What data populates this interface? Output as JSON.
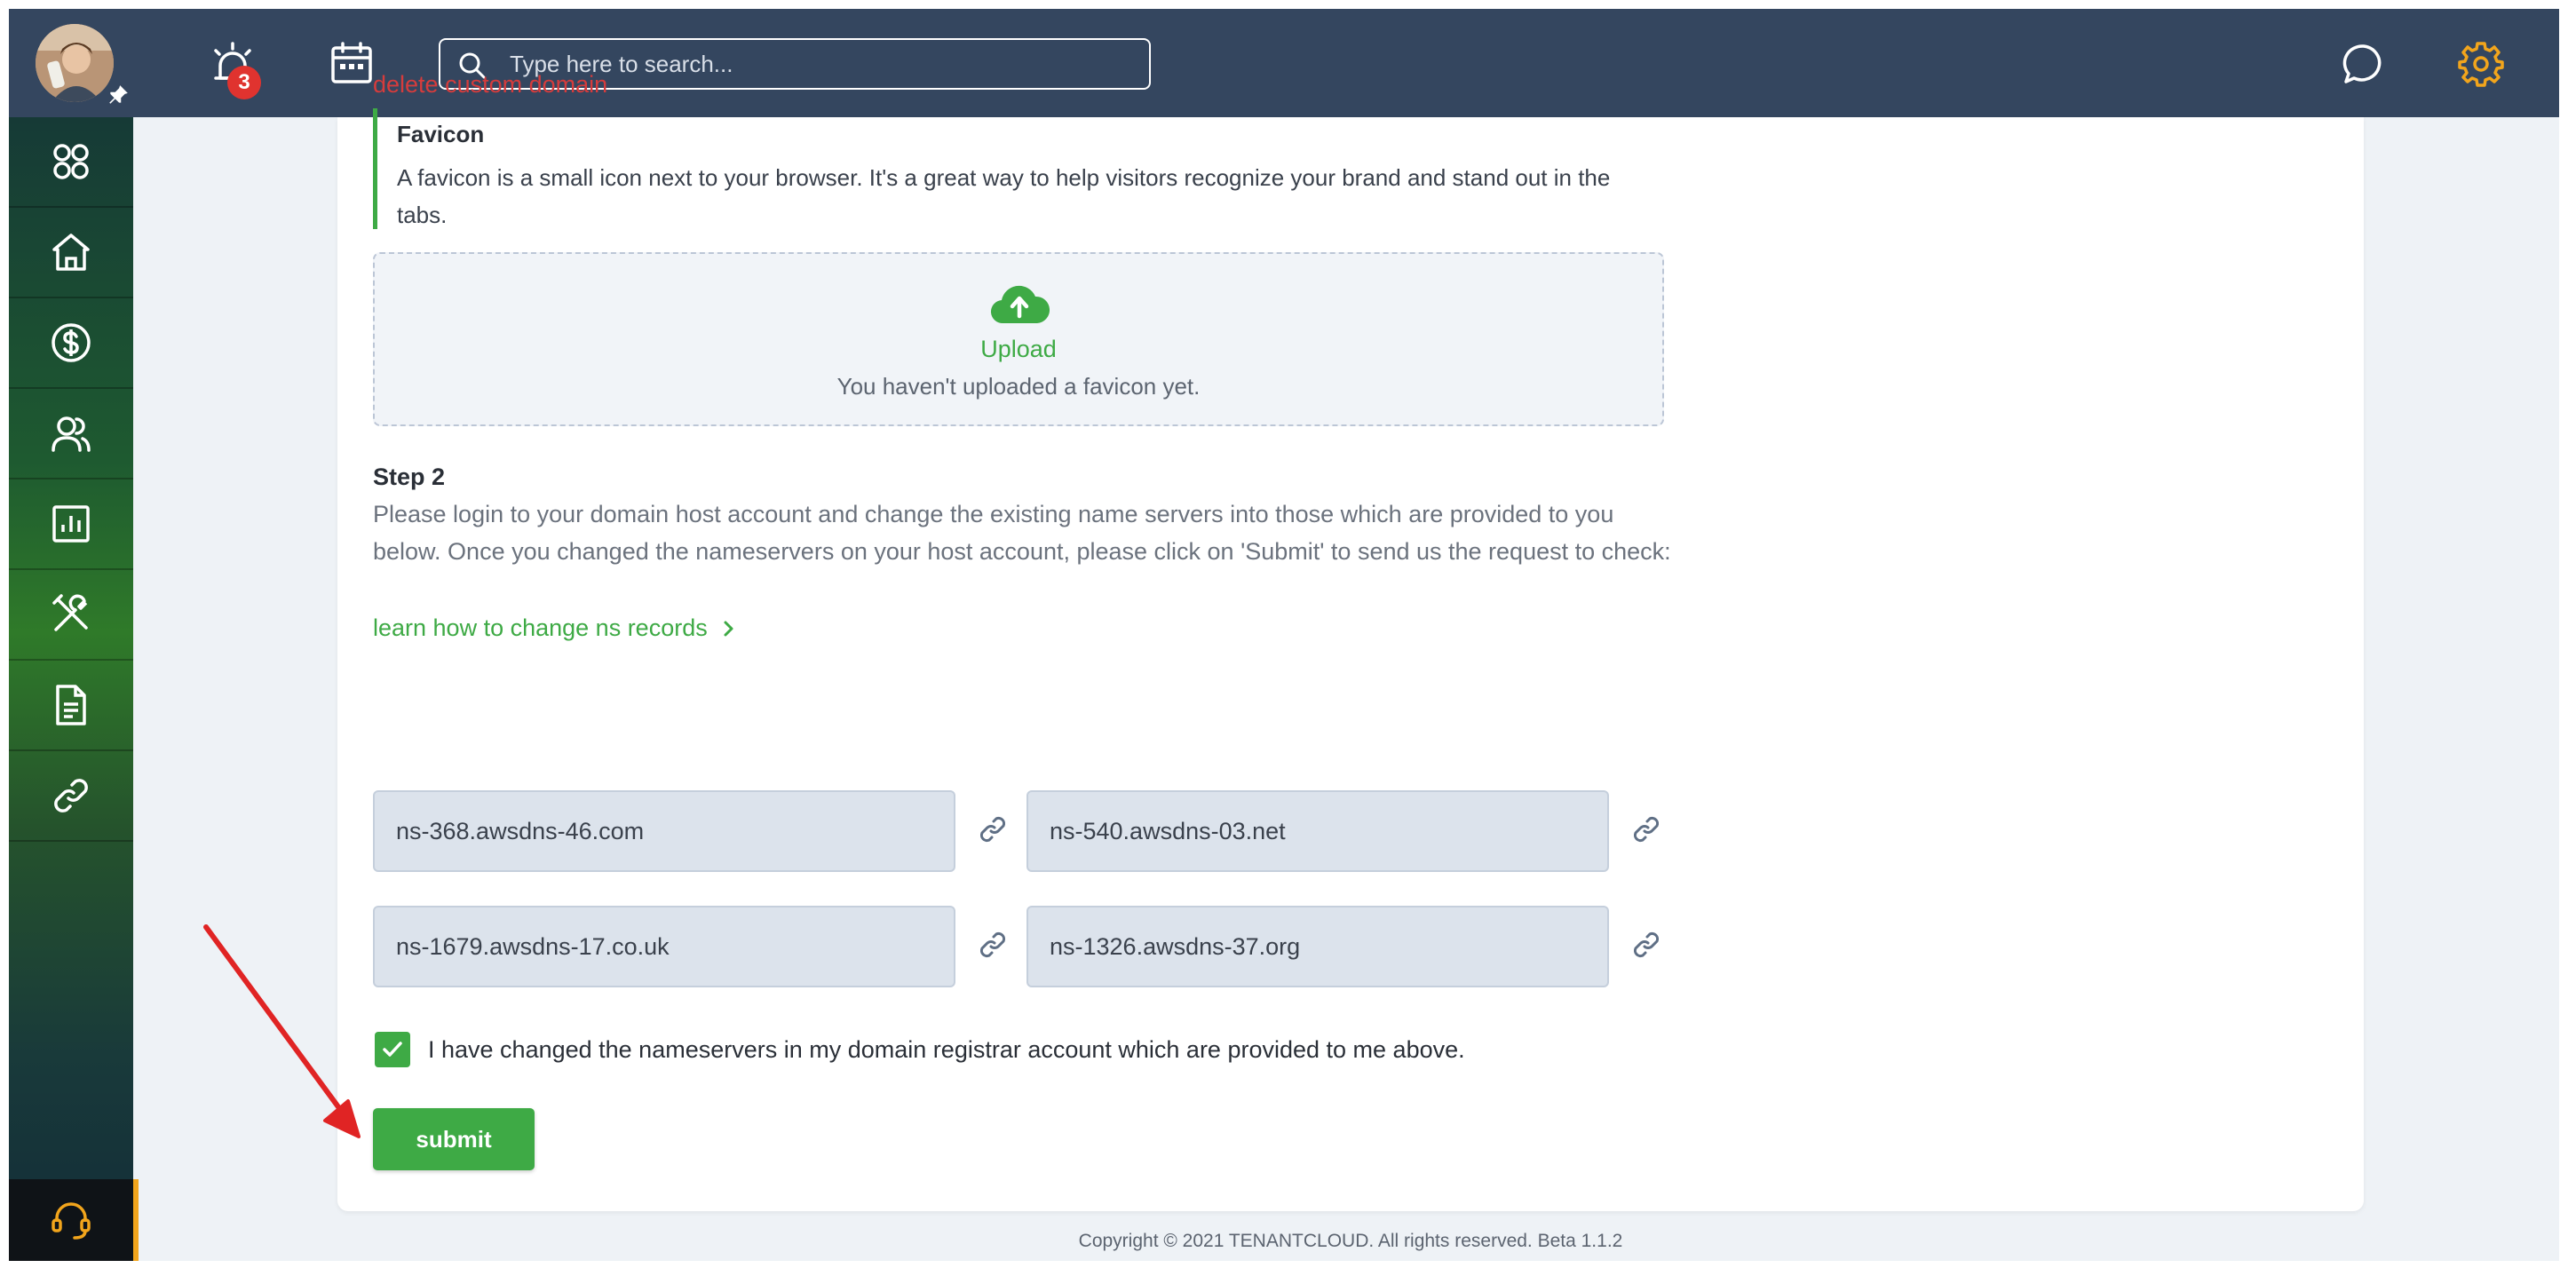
{
  "header": {
    "notifications_count": "3",
    "search_placeholder": "Type here to search...",
    "icons": [
      "avatar",
      "pin-icon",
      "alarm-icon",
      "calendar-icon",
      "search-icon",
      "chat-icon",
      "gear-icon"
    ]
  },
  "sidebar": {
    "items": [
      {
        "icon": "apps-grid-icon"
      },
      {
        "icon": "home-icon"
      },
      {
        "icon": "dollar-icon"
      },
      {
        "icon": "users-icon"
      },
      {
        "icon": "reports-chart-icon"
      },
      {
        "icon": "tools-icon"
      },
      {
        "icon": "document-icon"
      },
      {
        "icon": "link-icon"
      }
    ],
    "support_icon": "headset-icon"
  },
  "main": {
    "delete_link": "delete custom domain",
    "favicon": {
      "title": "Favicon",
      "description": "A favicon is a small icon next to your browser. It's a great way to help visitors recognize your brand and stand out in the tabs."
    },
    "upload": {
      "label": "Upload",
      "status": "You haven't uploaded a favicon yet."
    },
    "step2": {
      "title": "Step 2",
      "text": "Please login to your domain host account and change the existing name servers into those which are provided to you below. Once you changed the nameservers on your host account, please click on 'Submit' to send us the request to check:",
      "learn_link": "learn how to change ns records"
    },
    "nameservers": [
      "ns-368.awsdns-46.com",
      "ns-540.awsdns-03.net",
      "ns-1679.awsdns-17.co.uk",
      "ns-1326.awsdns-37.org"
    ],
    "agree_label": "I have changed the nameservers in my domain registrar account which are provided to me above.",
    "agree_checked": true,
    "submit_label": "submit"
  },
  "footer": {
    "copyright": "Copyright © 2021 TENANTCLOUD. All rights reserved. Beta 1.1.2"
  },
  "colors": {
    "topbar": "#34465f",
    "accent_green": "#3eaa45",
    "danger_red": "#d63c3c",
    "gear_orange": "#f2a51c",
    "annotation_arrow": "#e02424"
  }
}
